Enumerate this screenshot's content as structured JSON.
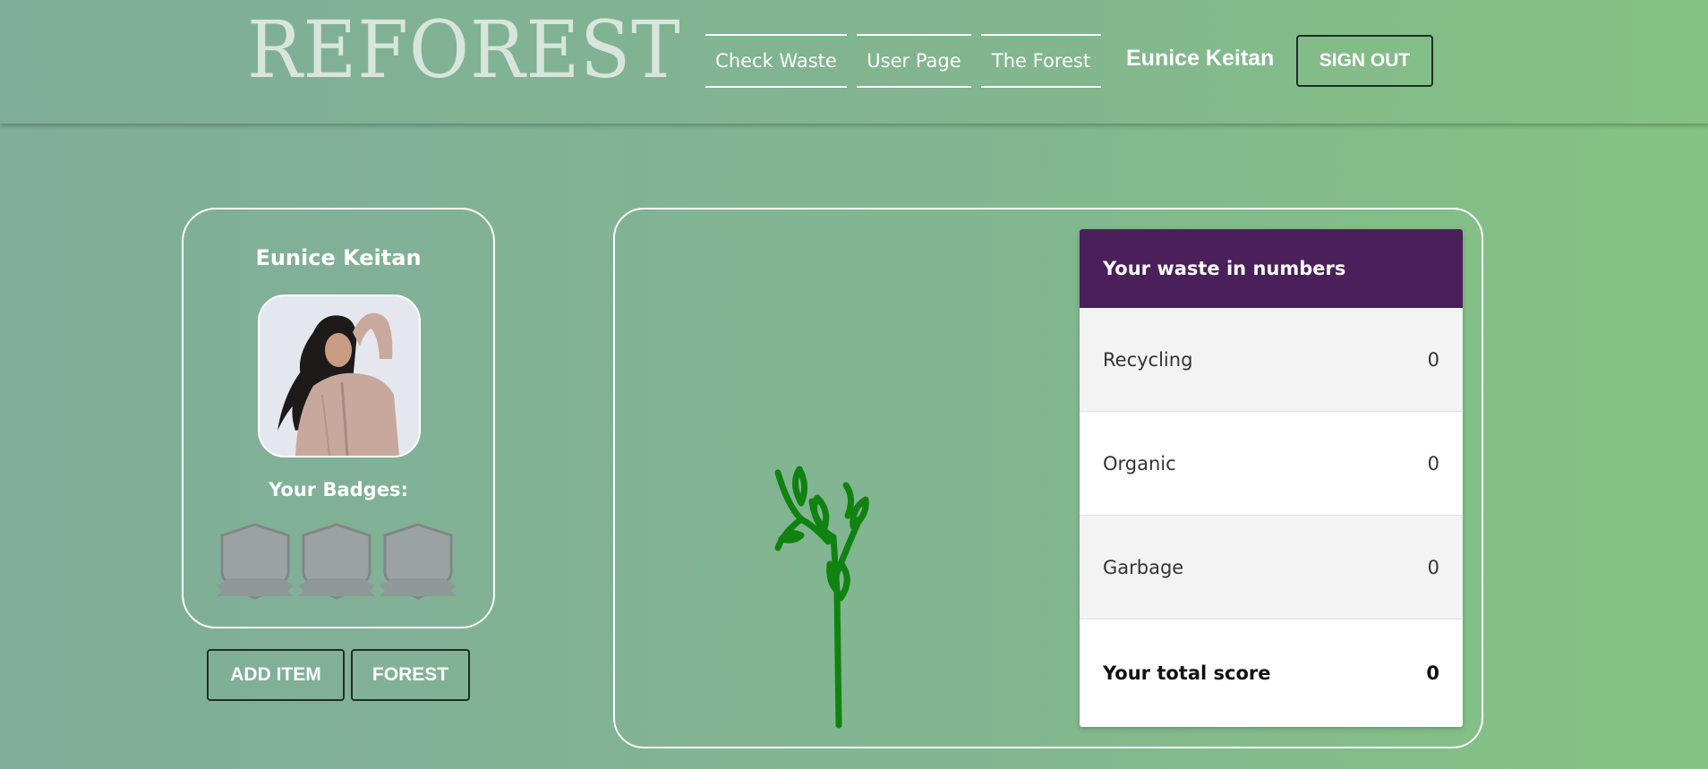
{
  "header": {
    "logo": "REFOREST",
    "nav": [
      {
        "label": "Check Waste"
      },
      {
        "label": "User Page"
      },
      {
        "label": "The Forest"
      }
    ],
    "user_name": "Eunice Keitan",
    "sign_out_label": "SIGN OUT"
  },
  "profile": {
    "name": "Eunice Keitan",
    "badges_label": "Your Badges:",
    "badges": [
      {
        "icon": "shield-badge-icon",
        "earned": false
      },
      {
        "icon": "shield-badge-icon",
        "earned": false
      },
      {
        "icon": "shield-badge-icon",
        "earned": false
      }
    ],
    "add_item_label": "ADD ITEM",
    "forest_label": "FOREST"
  },
  "stats": {
    "title": "Your waste in numbers",
    "rows": [
      {
        "label": "Recycling",
        "value": "0"
      },
      {
        "label": "Organic",
        "value": "0"
      },
      {
        "label": "Garbage",
        "value": "0"
      }
    ],
    "total": {
      "label": "Your total score",
      "value": "0"
    }
  },
  "colors": {
    "background_green": "#82b78f",
    "table_header": "#4b1f59",
    "plant_green": "#108210",
    "badge_gray": "#9aa3a2"
  }
}
